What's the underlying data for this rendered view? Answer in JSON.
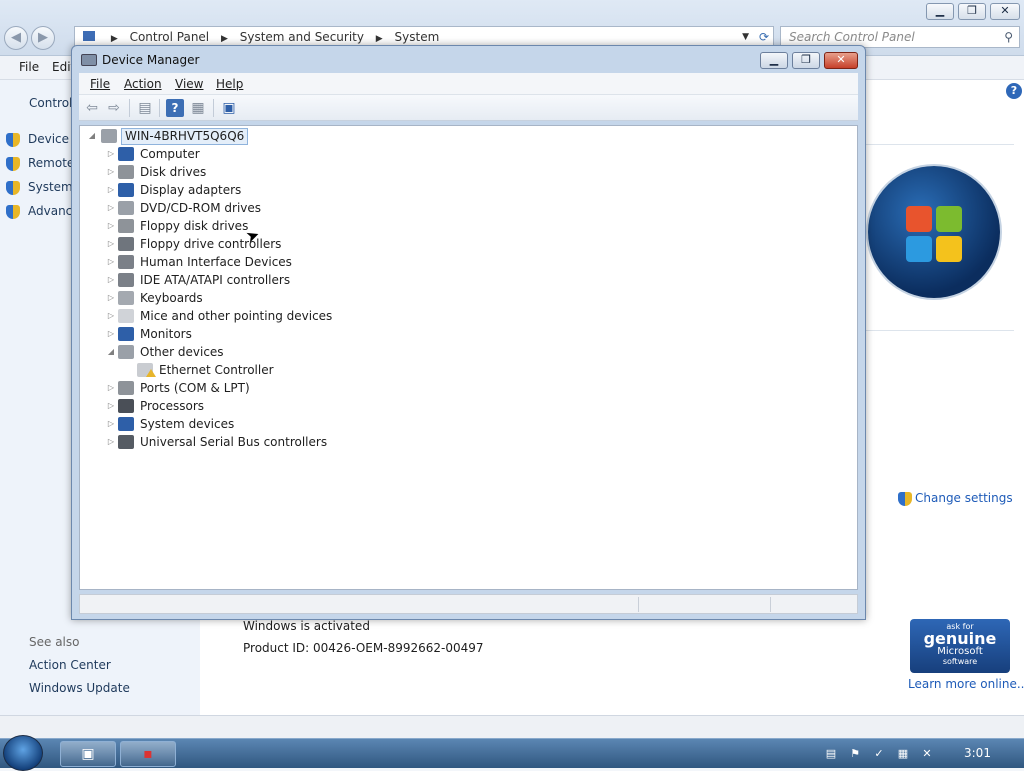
{
  "control_panel": {
    "breadcrumb": [
      "Control Panel",
      "System and Security",
      "System"
    ],
    "search_placeholder": "Search Control Panel",
    "menu": [
      "File",
      "Edit"
    ],
    "sidebar_header": "Control",
    "sidebar_links": [
      "Device M",
      "Remote",
      "System",
      "Advanc"
    ],
    "see_also_header": "See also",
    "see_also_links": [
      "Action Center",
      "Windows Update"
    ],
    "change_settings": "Change settings",
    "activation_status": "Windows is activated",
    "product_id": "Product ID: 00426-OEM-8992662-00497",
    "genuine_badge": [
      "ask for",
      "genuine",
      "Microsoft",
      "software"
    ],
    "learn_more": "Learn more online..."
  },
  "device_manager": {
    "title": "Device Manager",
    "menu": [
      "File",
      "Action",
      "View",
      "Help"
    ],
    "root": "WIN-4BRHVT5Q6Q6",
    "categories": [
      {
        "label": "Computer",
        "icon": "computer-icon",
        "color": "#2e5fa8"
      },
      {
        "label": "Disk drives",
        "icon": "disk-drive-icon",
        "color": "#8e9399"
      },
      {
        "label": "Display adapters",
        "icon": "display-adapter-icon",
        "color": "#2e5fa8"
      },
      {
        "label": "DVD/CD-ROM drives",
        "icon": "dvd-drive-icon",
        "color": "#9aa0a8"
      },
      {
        "label": "Floppy disk drives",
        "icon": "floppy-disk-icon",
        "color": "#8e9399"
      },
      {
        "label": "Floppy drive controllers",
        "icon": "floppy-controller-icon",
        "color": "#6f757d"
      },
      {
        "label": "Human Interface Devices",
        "icon": "hid-icon",
        "color": "#7b8088"
      },
      {
        "label": "IDE ATA/ATAPI controllers",
        "icon": "ide-controller-icon",
        "color": "#7b8088"
      },
      {
        "label": "Keyboards",
        "icon": "keyboard-icon",
        "color": "#a4a9b0"
      },
      {
        "label": "Mice and other pointing devices",
        "icon": "mouse-icon",
        "color": "#d0d3d8"
      },
      {
        "label": "Monitors",
        "icon": "monitor-icon",
        "color": "#2e5fa8"
      },
      {
        "label": "Other devices",
        "icon": "unknown-device-icon",
        "color": "#9aa0a8",
        "expanded": true
      },
      {
        "label": "Ports (COM & LPT)",
        "icon": "port-icon",
        "color": "#8e9399"
      },
      {
        "label": "Processors",
        "icon": "processor-icon",
        "color": "#4a4f57"
      },
      {
        "label": "System devices",
        "icon": "system-device-icon",
        "color": "#2e5fa8"
      },
      {
        "label": "Universal Serial Bus controllers",
        "icon": "usb-icon",
        "color": "#555b63"
      }
    ],
    "other_devices_children": [
      {
        "label": "Ethernet Controller",
        "icon": "warning-device-icon"
      }
    ]
  },
  "taskbar": {
    "clock": "3:01"
  }
}
